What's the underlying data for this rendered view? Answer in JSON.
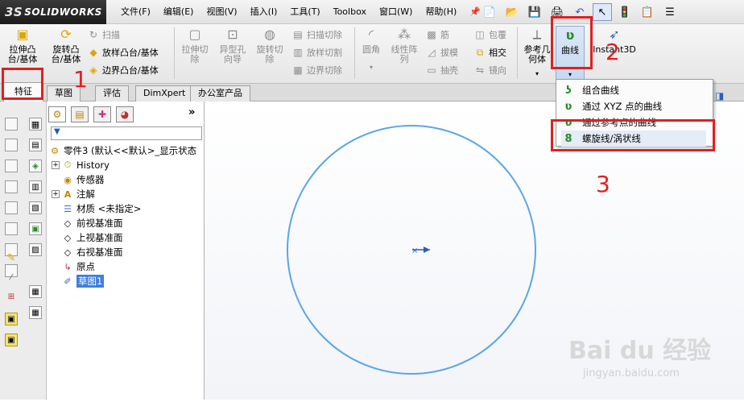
{
  "app": {
    "logo": "SOLIDWORKS",
    "logo_prefix": "3S"
  },
  "menu": [
    "文件(F)",
    "编辑(E)",
    "视图(V)",
    "插入(I)",
    "工具(T)",
    "Toolbox",
    "窗口(W)",
    "帮助(H)"
  ],
  "command_manager": {
    "extrude_boss": "拉伸凸\n台/基体",
    "revolve_boss": "旋转凸\n台/基体",
    "sweep": "扫描",
    "loft": "放样凸台/基体",
    "boundary": "边界凸台/基体",
    "extrude_cut": "拉伸切\n除",
    "hole_wizard": "异型孔\n向导",
    "revolve_cut": "旋转切\n除",
    "sweep_cut": "扫描切除",
    "loft_cut": "放样切割",
    "boundary_cut": "边界切除",
    "fillet": "圆角",
    "linear_pattern": "线性阵\n列",
    "rib": "筋",
    "draft": "拔模",
    "shell": "抽壳",
    "wrap": "包覆",
    "intersect": "相交",
    "mirror": "镜向",
    "ref_geometry": "参考几\n何体",
    "curves": "曲线",
    "instant3d": "Instant3D"
  },
  "tabs": [
    "特征",
    "草图",
    "评估",
    "DimXpert",
    "办公室产品"
  ],
  "feature_tree": {
    "filter_placeholder": "",
    "root": "零件3  (默认<<默认>_显示状态",
    "items": [
      {
        "label": "History",
        "icon": "history-icon",
        "expandable": true
      },
      {
        "label": "传感器",
        "icon": "sensor-icon",
        "expandable": false
      },
      {
        "label": "注解",
        "icon": "annotation-icon",
        "expandable": true
      },
      {
        "label": "材质 <未指定>",
        "icon": "material-icon",
        "expandable": false
      },
      {
        "label": "前视基准面",
        "icon": "plane-icon",
        "expandable": false
      },
      {
        "label": "上视基准面",
        "icon": "plane-icon",
        "expandable": false
      },
      {
        "label": "右视基准面",
        "icon": "plane-icon",
        "expandable": false
      },
      {
        "label": "原点",
        "icon": "origin-icon",
        "expandable": false
      },
      {
        "label": "草图1",
        "icon": "sketch-icon",
        "expandable": false,
        "selected": true
      }
    ]
  },
  "curves_dropdown": [
    "组合曲线",
    "通过 XYZ 点的曲线",
    "通过参考点的曲线",
    "螺旋线/涡状线"
  ],
  "annotations": [
    "1",
    "2",
    "3"
  ],
  "watermark": {
    "brand": "Bai du 经验",
    "url": "jingyan.baidu.com"
  },
  "colors": {
    "sketch_circle": "#5aa6e8",
    "annotation_red": "#e02020",
    "selection_blue": "#3d80df"
  }
}
